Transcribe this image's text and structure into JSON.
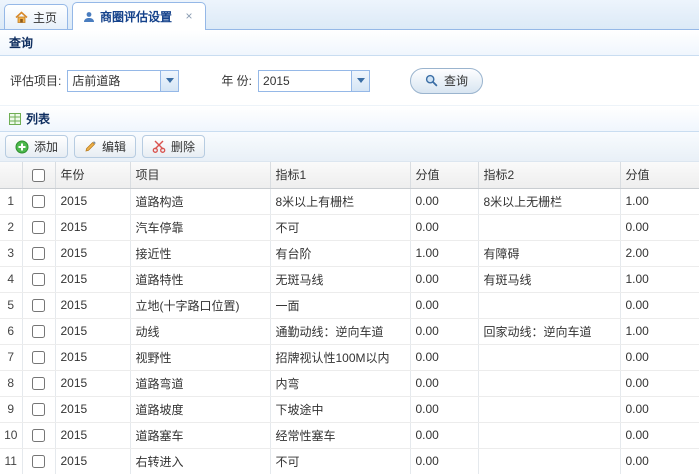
{
  "tabs": [
    {
      "label": "主页"
    },
    {
      "label": "商圈评估设置",
      "close": "×"
    }
  ],
  "query_panel": {
    "title": "查询",
    "fields": [
      {
        "label": "评估项目:",
        "value": "店前道路"
      },
      {
        "label": "年 份:",
        "value": "2015"
      }
    ],
    "search_button": "查询"
  },
  "list_panel": {
    "title": "列表",
    "toolbar": {
      "add_label": "添加",
      "edit_label": "编辑",
      "delete_label": "删除"
    },
    "table": {
      "columns": [
        "年份",
        "项目",
        "指标1",
        "分值",
        "指标2",
        "分值"
      ],
      "rows": [
        {
          "num": "1",
          "year": "2015",
          "project": "道路构造",
          "ind1": "8米以上有栅栏",
          "score1": "0.00",
          "ind2": "8米以上无栅栏",
          "score2": "1.00"
        },
        {
          "num": "2",
          "year": "2015",
          "project": "汽车停靠",
          "ind1": "不可",
          "score1": "0.00",
          "ind2": "",
          "score2": "0.00"
        },
        {
          "num": "3",
          "year": "2015",
          "project": "接近性",
          "ind1": "有台阶",
          "score1": "1.00",
          "ind2": "有障碍",
          "score2": "2.00"
        },
        {
          "num": "4",
          "year": "2015",
          "project": "道路特性",
          "ind1": "无斑马线",
          "score1": "0.00",
          "ind2": "有斑马线",
          "score2": "1.00"
        },
        {
          "num": "5",
          "year": "2015",
          "project": "立地(十字路口位置)",
          "ind1": "一面",
          "score1": "0.00",
          "ind2": "",
          "score2": "0.00"
        },
        {
          "num": "6",
          "year": "2015",
          "project": "动线",
          "ind1": "通勤动线：逆向车道",
          "score1": "0.00",
          "ind2": "回家动线：逆向车道",
          "score2": "1.00"
        },
        {
          "num": "7",
          "year": "2015",
          "project": "视野性",
          "ind1": "招牌视认性100M以内",
          "score1": "0.00",
          "ind2": "",
          "score2": "0.00"
        },
        {
          "num": "8",
          "year": "2015",
          "project": "道路弯道",
          "ind1": "内弯",
          "score1": "0.00",
          "ind2": "",
          "score2": "0.00"
        },
        {
          "num": "9",
          "year": "2015",
          "project": "道路坡度",
          "ind1": "下坡途中",
          "score1": "0.00",
          "ind2": "",
          "score2": "0.00"
        },
        {
          "num": "10",
          "year": "2015",
          "project": "道路塞车",
          "ind1": "经常性塞车",
          "score1": "0.00",
          "ind2": "",
          "score2": "0.00"
        },
        {
          "num": "11",
          "year": "2015",
          "project": "右转进入",
          "ind1": "不可",
          "score1": "0.00",
          "ind2": "",
          "score2": "0.00"
        }
      ]
    }
  },
  "colors": {
    "border_blue": "#95B8E7",
    "active_tab_text": "#15428B",
    "panel_title_text": "#0E2D5F",
    "add_green": "#3DAE3D",
    "edit_orange": "#E9A33C",
    "delete_red": "#D9534F"
  }
}
